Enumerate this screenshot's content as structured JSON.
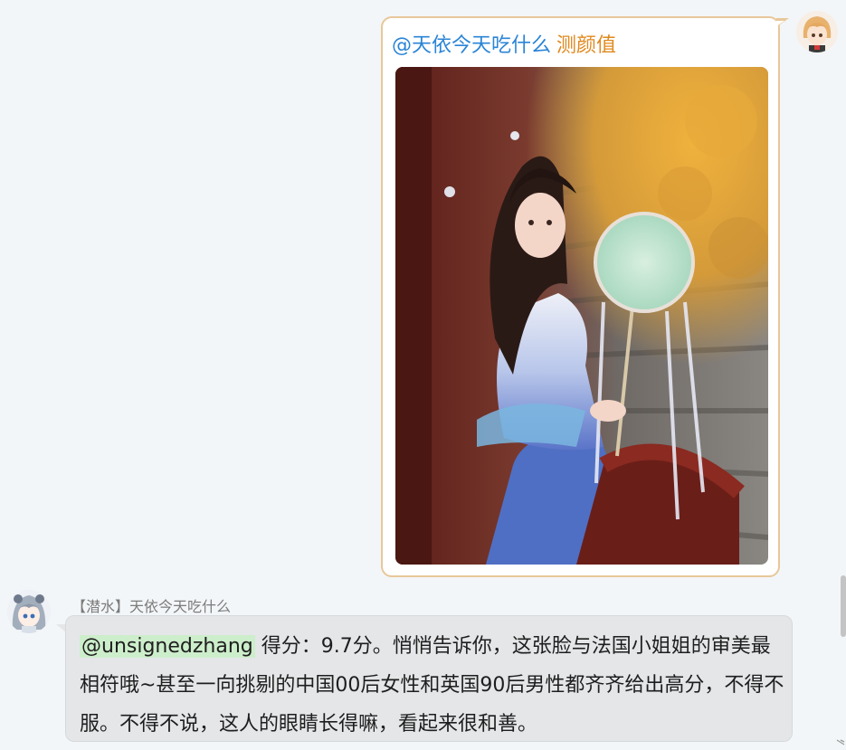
{
  "sent_message": {
    "mention": "@天依今天吃什么",
    "command": "测颜值"
  },
  "received_message": {
    "sender": "【潜水】天依今天吃什么",
    "mention": "@unsignedzhang",
    "text": " 得分：9.7分。悄悄告诉你，这张脸与法国小姐姐的审美最相符哦~甚至一向挑剔的中国00后女性和英国90后男性都齐齐给出高分，不得不服。不得不说，这人的眼睛长得嘛，看起来很和善。"
  },
  "colors": {
    "mention": "#2a84d6",
    "command": "#e0891e",
    "sent_border": "#e8c79a",
    "mention_highlight": "#cdeecb"
  },
  "icons": [
    "user-avatar-icon",
    "bot-avatar-icon",
    "resize-grip-icon"
  ]
}
